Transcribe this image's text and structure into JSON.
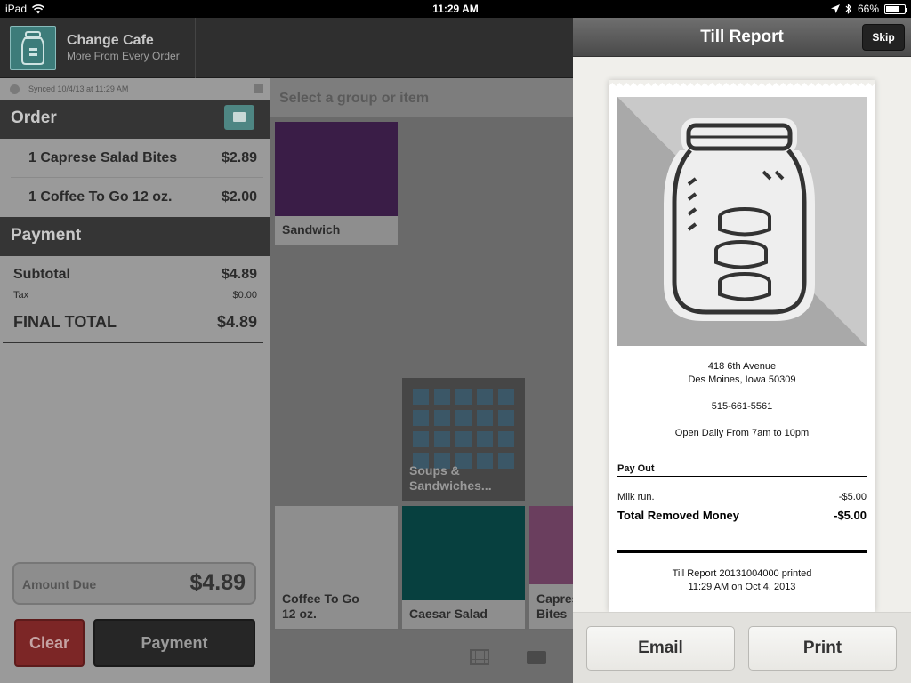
{
  "status_bar": {
    "device": "iPad",
    "time": "11:29 AM",
    "battery": "66%",
    "battery_level": 0.66
  },
  "header": {
    "cafe_name": "Change Cafe",
    "tagline": "More From Every Order"
  },
  "order": {
    "sync_text": "Synced 10/4/13 at 11:29 AM",
    "order_title": "Order",
    "items": [
      {
        "label": "1 Caprese Salad Bites",
        "price": "$2.89"
      },
      {
        "label": "1 Coffee To Go 12 oz.",
        "price": "$2.00"
      }
    ],
    "payment_title": "Payment",
    "subtotal_label": "Subtotal",
    "subtotal_value": "$4.89",
    "tax_label": "Tax",
    "tax_value": "$0.00",
    "final_label": "FINAL TOTAL",
    "final_value": "$4.89",
    "amount_due_label": "Amount Due",
    "amount_due_value": "$4.89",
    "clear_label": "Clear",
    "payment_label": "Payment"
  },
  "catalog": {
    "search_placeholder": "Select a group or item",
    "tiles": [
      {
        "label": "Sandwich",
        "color": "#3a1d47"
      },
      {
        "label": "Soups & Sandwiches...",
        "color": "#464646"
      },
      {
        "label": "Coffee To Go 12 oz.",
        "color": "#8e8e8e"
      },
      {
        "label": "Caesar Salad",
        "color": "#07403f"
      },
      {
        "label": "Caprese Salad Bites",
        "color": "#6a3e5e"
      }
    ],
    "view_icons": [
      "grid-view-icon",
      "tile-view-icon"
    ]
  },
  "till_report": {
    "title": "Till Report",
    "skip_label": "Skip",
    "address_line1": "418 6th Avenue",
    "address_line2": "Des Moines, Iowa 50309",
    "phone": "515-661-5561",
    "hours": "Open Daily From 7am to 10pm",
    "payout_header": "Pay Out",
    "payout_item_label": "Milk run.",
    "payout_item_value": "-$5.00",
    "total_label": "Total Removed Money",
    "total_value": "-$5.00",
    "printed_line1": "Till Report 20131004000 printed",
    "printed_line2": "11:29 AM on Oct 4, 2013",
    "email_label": "Email",
    "print_label": "Print"
  },
  "colors": {
    "accent_teal": "#3d7c7a",
    "clear_red": "#7c2626"
  }
}
